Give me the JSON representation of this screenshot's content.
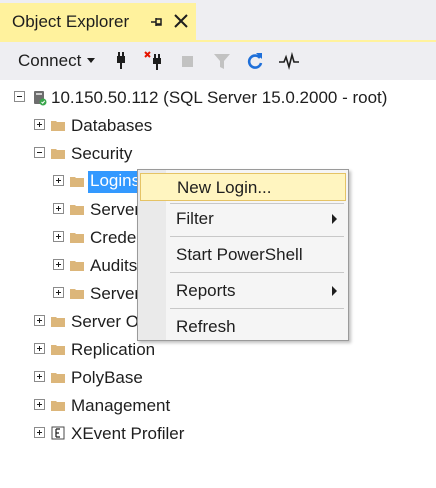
{
  "panel": {
    "title": "Object Explorer",
    "pin_icon": "pin-icon",
    "close_icon": "close-icon"
  },
  "toolbar": {
    "connect_label": "Connect",
    "icons": [
      "connect-plug-icon",
      "disconnect-icon",
      "stop-icon",
      "filter-icon",
      "refresh-icon",
      "activity-monitor-icon"
    ]
  },
  "tree": {
    "server": "10.150.50.112 (SQL Server 15.0.2000 - root)",
    "nodes": [
      {
        "label": "Databases",
        "expanded": false
      },
      {
        "label": "Security",
        "expanded": true,
        "children": [
          {
            "label": "Logins",
            "selected": true
          },
          {
            "label": "Server"
          },
          {
            "label": "Crede"
          },
          {
            "label": "Audits"
          },
          {
            "label": "Server"
          }
        ]
      },
      {
        "label": "Server O",
        "expanded": false
      },
      {
        "label": "Replication",
        "expanded": false
      },
      {
        "label": "PolyBase",
        "expanded": false
      },
      {
        "label": "Management",
        "expanded": false
      },
      {
        "label": "XEvent Profiler",
        "expanded": false
      }
    ]
  },
  "context_menu": {
    "items": [
      {
        "label": "New Login...",
        "highlighted": true
      },
      {
        "label": "Filter",
        "submenu": true
      },
      {
        "label": "Start PowerShell"
      },
      {
        "label": "Reports",
        "submenu": true
      },
      {
        "label": "Refresh"
      }
    ]
  },
  "colors": {
    "active_tab": "#fff29d",
    "selection": "#3399ff",
    "folder": "#dcb67a",
    "menu_hover": "#fff5c0"
  }
}
